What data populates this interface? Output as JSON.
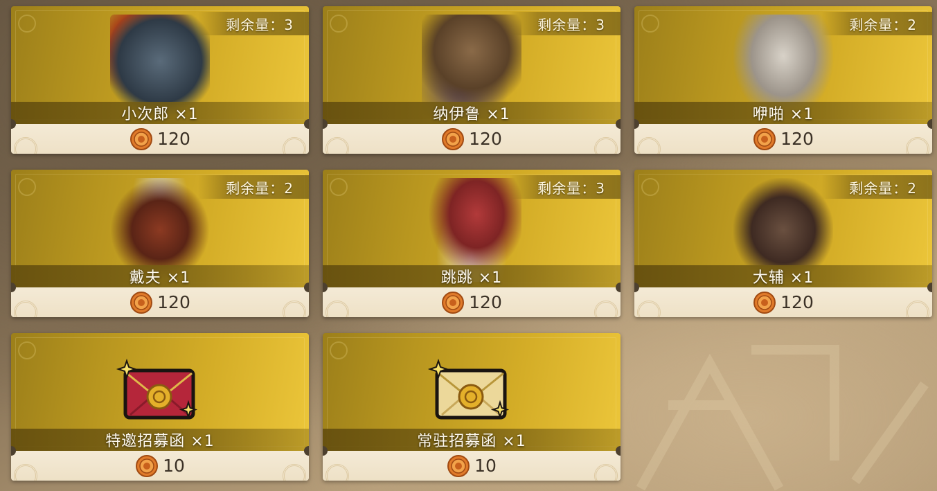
{
  "shop": {
    "remain_prefix": "剩余量：",
    "currency_icon": "gear-coin-icon",
    "items": [
      {
        "name": "小次郎 ×1",
        "remain": "剩余量：3",
        "price": "120",
        "type": "portrait",
        "icon": "palico-kojiro-portrait",
        "accent": "#c9641f"
      },
      {
        "name": "纳伊鲁 ×1",
        "remain": "剩余量：3",
        "price": "120",
        "type": "portrait",
        "icon": "palico-nairu-portrait",
        "accent": "#7a5a3a"
      },
      {
        "name": "咿啪 ×1",
        "remain": "剩余量：2",
        "price": "120",
        "type": "portrait",
        "icon": "palico-ipa-portrait",
        "accent": "#b8323a"
      },
      {
        "name": "戴夫 ×1",
        "remain": "剩余量：2",
        "price": "120",
        "type": "portrait",
        "icon": "palico-dave-portrait",
        "accent": "#8c3a22"
      },
      {
        "name": "跳跳 ×1",
        "remain": "剩余量：3",
        "price": "120",
        "type": "portrait",
        "icon": "palico-tiaotiao-portrait",
        "accent": "#b23a3a"
      },
      {
        "name": "大辅 ×1",
        "remain": "剩余量：2",
        "price": "120",
        "type": "portrait",
        "icon": "palico-daisuke-portrait",
        "accent": "#6e2d24"
      },
      {
        "name": "特邀招募函 ×1",
        "remain": "",
        "price": "10",
        "type": "letter",
        "icon": "special-recruit-letter-icon",
        "accent": "#b5263a"
      },
      {
        "name": "常驻招募函 ×1",
        "remain": "",
        "price": "10",
        "type": "letter",
        "icon": "standard-recruit-letter-icon",
        "accent": "#e8d08a"
      }
    ]
  }
}
